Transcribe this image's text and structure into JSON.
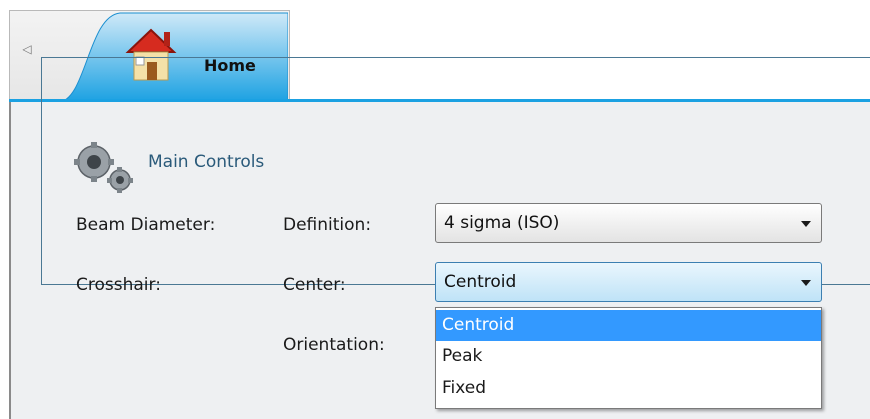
{
  "tabs": [
    {
      "label": "Home",
      "icon": "house-icon",
      "active": true
    }
  ],
  "tab_scroll_icon": "chevron-left-icon",
  "group": {
    "title": "Main Controls",
    "icon": "gears-icon"
  },
  "rows": {
    "beam_diameter": {
      "label": "Beam Diameter:",
      "sub_label": "Definition:",
      "value": "4 sigma (ISO)"
    },
    "crosshair": {
      "label": "Crosshair:",
      "center_label": "Center:",
      "center_value": "Centroid",
      "orientation_label": "Orientation:"
    }
  },
  "dropdown": {
    "options": [
      "Centroid",
      "Peak",
      "Fixed"
    ],
    "selected": "Centroid"
  },
  "colors": {
    "accent": "#1ba1e2",
    "selection": "#3399ff",
    "group_title": "#2a5a7a"
  }
}
